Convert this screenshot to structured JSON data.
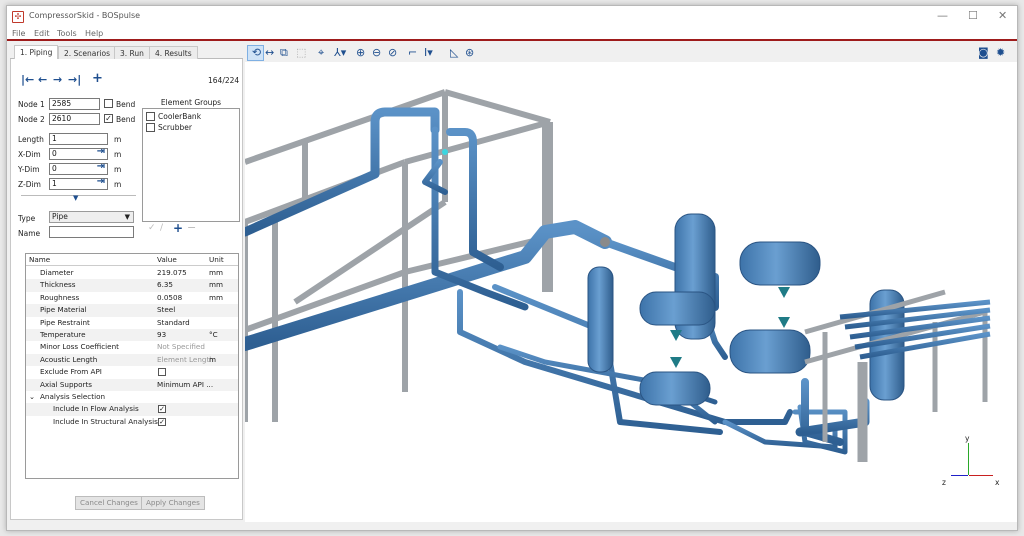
{
  "window": {
    "title": "CompressorSkid - BOSpulse",
    "minimize_glyph": "—",
    "maximize_glyph": "☐",
    "close_glyph": "✕"
  },
  "menu": [
    "File",
    "Edit",
    "Tools",
    "Help"
  ],
  "tabs": [
    "1. Piping",
    "2. Scenarios",
    "3. Run",
    "4. Results"
  ],
  "nav": {
    "counter": "164/224",
    "first": "|←",
    "prev": "←",
    "next": "→",
    "last": "→|",
    "add": "+"
  },
  "form": {
    "node1_label": "Node 1",
    "node1_value": "2585",
    "node1_bend_label": "Bend",
    "node1_bend_checked": false,
    "node2_label": "Node 2",
    "node2_value": "2610",
    "node2_bend_label": "Bend",
    "node2_bend_checked": true,
    "length_label": "Length",
    "length_value": "1",
    "length_unit": "m",
    "xdim_label": "X-Dim",
    "xdim_value": "0",
    "xdim_unit": "m",
    "ydim_label": "Y-Dim",
    "ydim_value": "0",
    "ydim_unit": "m",
    "zdim_label": "Z-Dim",
    "zdim_value": "1",
    "zdim_unit": "m",
    "type_label": "Type",
    "type_value": "Pipe",
    "name_label": "Name",
    "name_value": ""
  },
  "element_groups": {
    "title": "Element Groups",
    "items": [
      {
        "label": "CoolerBank",
        "checked": false
      },
      {
        "label": "Scrubber",
        "checked": false
      }
    ]
  },
  "properties": {
    "headers": [
      "Name",
      "Value",
      "Unit"
    ],
    "rows": [
      {
        "name": "Diameter",
        "value": "219.075",
        "unit": "mm",
        "kind": "text"
      },
      {
        "name": "Thickness",
        "value": "6.35",
        "unit": "mm",
        "kind": "text"
      },
      {
        "name": "Roughness",
        "value": "0.0508",
        "unit": "mm",
        "kind": "text"
      },
      {
        "name": "Pipe Material",
        "value": "Steel",
        "unit": "",
        "kind": "text"
      },
      {
        "name": "Pipe Restraint",
        "value": "Standard",
        "unit": "",
        "kind": "text"
      },
      {
        "name": "Temperature",
        "value": "93",
        "unit": "°C",
        "kind": "text"
      },
      {
        "name": "Minor Loss Coefficient",
        "value": "Not Specified",
        "unit": "",
        "kind": "grey"
      },
      {
        "name": "Acoustic Length",
        "value": "Element Length",
        "unit": "m",
        "kind": "grey"
      },
      {
        "name": "Exclude From API",
        "value": "",
        "unit": "",
        "kind": "checkbox",
        "checked": false
      },
      {
        "name": "Axial Supports",
        "value": "Minimum API ...",
        "unit": "",
        "kind": "text"
      },
      {
        "name": "Analysis Selection",
        "value": "",
        "unit": "",
        "kind": "group"
      },
      {
        "name": "Include In Flow Analysis",
        "value": "",
        "unit": "",
        "kind": "checkbox",
        "checked": true
      },
      {
        "name": "Include In Structural Analysis",
        "value": "",
        "unit": "",
        "kind": "checkbox",
        "checked": true
      }
    ]
  },
  "buttons": {
    "cancel": "Cancel Changes",
    "apply": "Apply Changes"
  },
  "axes": {
    "x": "x",
    "y": "y",
    "z": "z"
  }
}
